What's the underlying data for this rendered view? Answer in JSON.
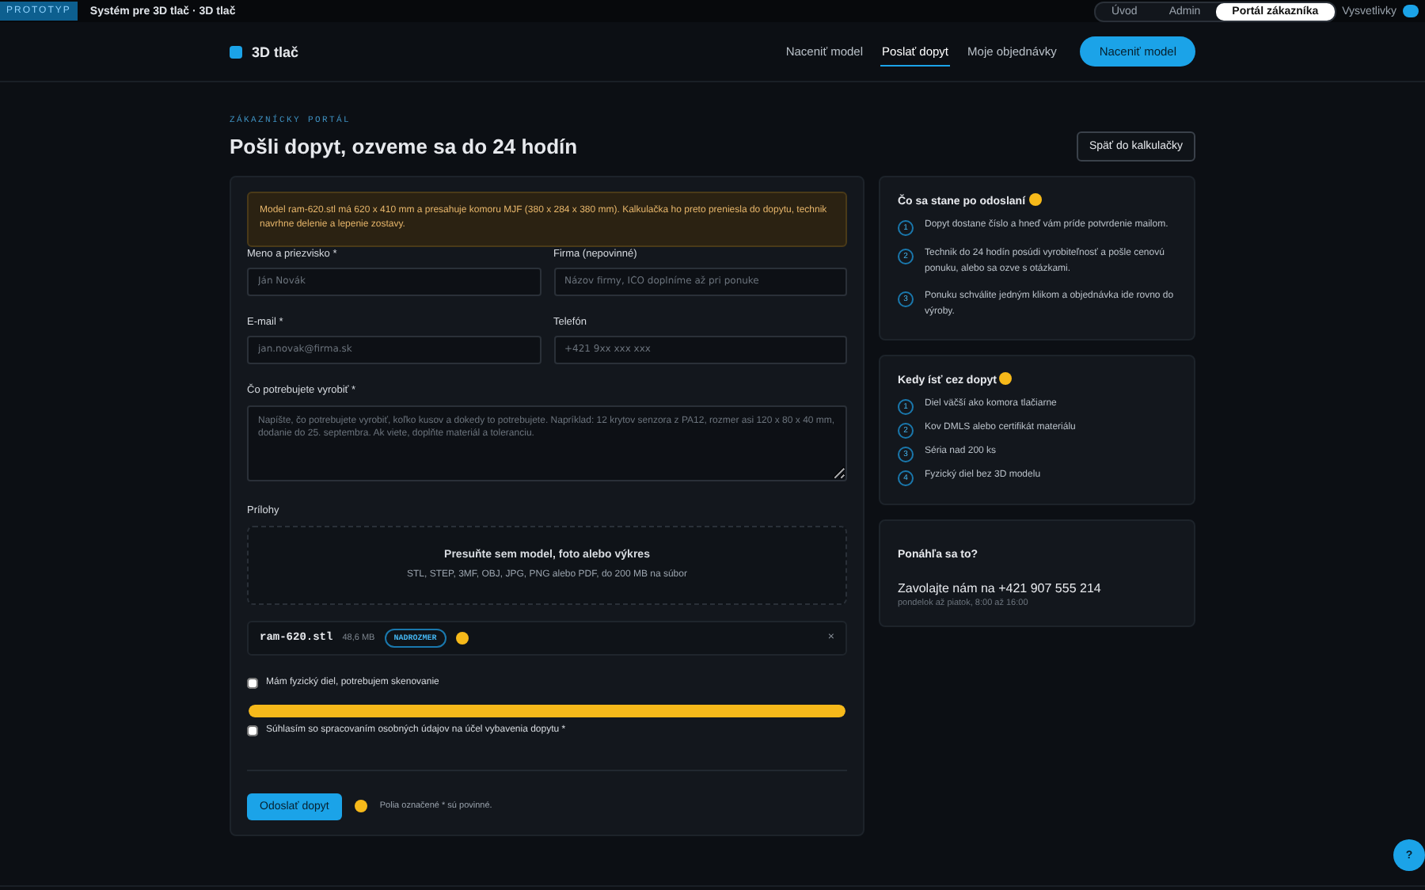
{
  "topbar": {
    "badge": "PROTOTYP",
    "title": "Systém pre 3D tlač · 3D tlač",
    "views": [
      {
        "label": "Úvod",
        "selected": false
      },
      {
        "label": "Admin",
        "selected": false
      },
      {
        "label": "Portál zákazníka",
        "selected": true
      }
    ],
    "hints_toggle": {
      "label": "Vysvetlivky",
      "on": true
    }
  },
  "header": {
    "logo": "3D tlač",
    "nav": [
      {
        "label": "Naceniť model",
        "selected": false
      },
      {
        "label": "Poslať dopyt",
        "selected": true
      },
      {
        "label": "Moje objednávky",
        "selected": false
      }
    ],
    "cta": "Naceniť model"
  },
  "page": {
    "eyebrow": "ZÁKAZNÍCKY PORTÁL",
    "title": "Pošli dopyt, ozveme sa do 24 hodín",
    "back_button": "Späť do kalkulačky"
  },
  "form": {
    "warning": "Model ram-620.stl má 620 x 410 mm a presahuje komoru MJF (380 x 284 x 380 mm). Kalkulačka ho preto preniesla do dopytu, technik navrhne delenie a lepenie zostavy.",
    "fields": [
      {
        "label": "Meno a priezvisko *",
        "placeholder": "Ján Novák"
      },
      {
        "label": "Firma (nepovinné)",
        "placeholder": "Názov firmy, IČO doplníme až pri ponuke"
      },
      {
        "label": "E-mail *",
        "placeholder": "jan.novak@firma.sk"
      },
      {
        "label": "Telefón",
        "placeholder": "+421 9xx xxx xxx"
      }
    ],
    "description": {
      "label": "Čo potrebujete vyrobiť *",
      "placeholder": "Napíšte, čo potrebujete vyrobiť, koľko kusov a dokedy to potrebujete. Napríklad: 12 krytov senzora z PA12, rozmer asi 120 x 80 x 40 mm, dodanie do 25. septembra. Ak viete, doplňte materiál a toleranciu."
    },
    "attachments": {
      "label": "Prílohy",
      "drop_title": "Presuňte sem model, foto alebo výkres",
      "drop_hint": "STL, STEP, 3MF, OBJ, JPG, PNG alebo PDF, do 200 MB na súbor",
      "files": [
        {
          "name": "ram-620.stl",
          "size": "48,6 MB",
          "tag": "NADROZMER",
          "hint": true,
          "remove": "×"
        }
      ]
    },
    "scan": {
      "label": "Mám fyzický diel, potrebujem skenovanie",
      "checked": false
    },
    "progress": {
      "level": 1
    },
    "consent": {
      "label": "Súhlasím so spracovaním osobných údajov na účel vybavenia dopytu *",
      "checked": false
    },
    "submit": "Odoslať dopyt",
    "submit_hint": true,
    "required_note": "Polia označené * sú povinné."
  },
  "sidebar": [
    {
      "title": "Čo sa stane po odoslaní",
      "hint": true,
      "steps": [
        {
          "num": "1",
          "text": "Dopyt dostane číslo a hneď vám príde potvrdenie mailom."
        },
        {
          "num": "2",
          "text": "Technik do 24 hodín posúdi vyrobiteľnosť a pošle cenovú ponuku, alebo sa ozve s otázkami."
        },
        {
          "num": "3",
          "text": "Ponuku schválite jedným klikom a objednávka ide rovno do výroby."
        }
      ]
    },
    {
      "title": "Kedy ísť cez dopyt",
      "hint": true,
      "steps": [
        {
          "num": "1",
          "text": "Diel väčší ako komora tlačiarne"
        },
        {
          "num": "2",
          "text": "Kov DMLS alebo certifikát materiálu"
        },
        {
          "num": "3",
          "text": "Séria nad 200 ks"
        },
        {
          "num": "4",
          "text": "Fyzický diel bez 3D modelu"
        }
      ]
    }
  ],
  "contact": {
    "title": "Ponáhľa sa to?",
    "call_text": "Zavolajte nám na",
    "phone": "+421 907 555 214",
    "hours": "pondelok až piatok, 8:00 až 16:00"
  },
  "help_button": "?"
}
